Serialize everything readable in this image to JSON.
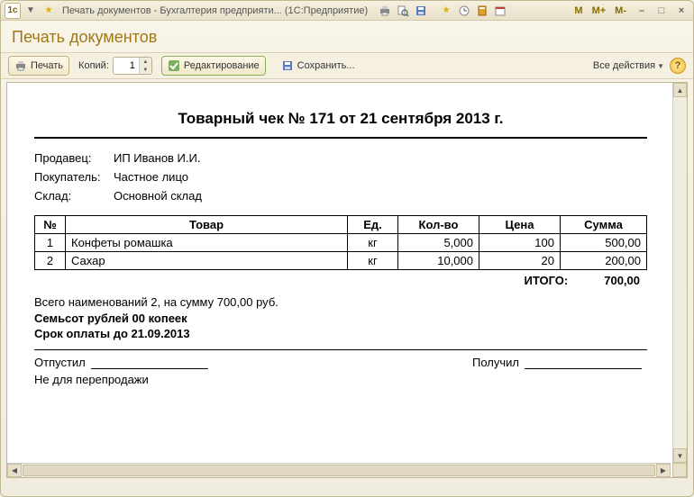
{
  "window": {
    "title": "Печать документов - Бухгалтерия предприяти...  (1С:Предприятие)",
    "mem_m": "M",
    "mem_mplus": "M+",
    "mem_mminus": "M-"
  },
  "header": {
    "title": "Печать документов"
  },
  "toolbar": {
    "print_label": "Печать",
    "copies_label": "Копий:",
    "copies_value": "1",
    "edit_label": "Редактирование",
    "save_label": "Сохранить...",
    "all_actions": "Все действия"
  },
  "doc": {
    "title": "Товарный чек № 171 от 21 сентября 2013 г.",
    "seller_label": "Продавец:",
    "seller_value": "ИП Иванов И.И.",
    "buyer_label": "Покупатель:",
    "buyer_value": "Частное лицо",
    "warehouse_label": "Склад:",
    "warehouse_value": "Основной склад",
    "cols": {
      "num": "№",
      "name": "Товар",
      "unit": "Ед.",
      "qty": "Кол-во",
      "price": "Цена",
      "sum": "Сумма"
    },
    "rows": [
      {
        "n": "1",
        "name": "Конфеты ромашка",
        "unit": "кг",
        "qty": "5,000",
        "price": "100",
        "sum": "500,00"
      },
      {
        "n": "2",
        "name": "Сахар",
        "unit": "кг",
        "qty": "10,000",
        "price": "20",
        "sum": "200,00"
      }
    ],
    "total_label": "ИТОГО:",
    "total_value": "700,00",
    "summary1": "Всего наименований 2, на сумму 700,00 руб.",
    "summary2": "Семьсот рублей 00 копеек",
    "summary3": "Срок оплаты до 21.09.2013",
    "released": "Отпустил",
    "received": "Получил",
    "noresale": "Не для перепродажи"
  }
}
